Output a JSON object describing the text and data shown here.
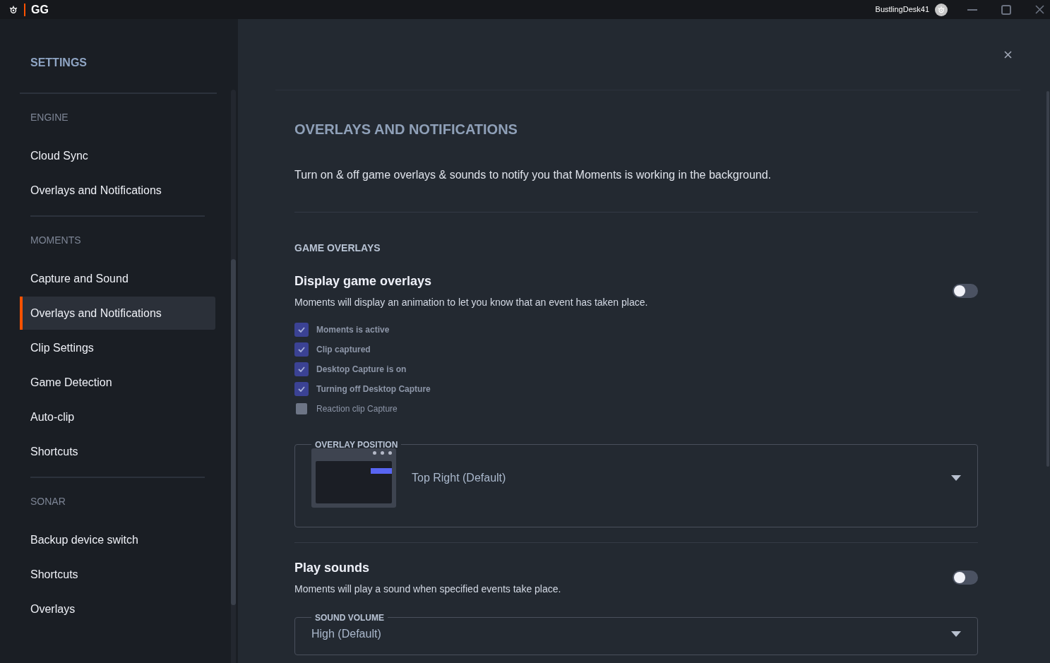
{
  "titlebar": {
    "app_name": "GG",
    "username": "BustlingDesk41"
  },
  "sidebar": {
    "title": "SETTINGS",
    "sections": [
      {
        "header": "ENGINE",
        "items": [
          {
            "label": "Cloud Sync",
            "selected": false
          },
          {
            "label": "Overlays and Notifications",
            "selected": false
          }
        ]
      },
      {
        "header": "MOMENTS",
        "items": [
          {
            "label": "Capture and Sound",
            "selected": false
          },
          {
            "label": "Overlays and Notifications",
            "selected": true
          },
          {
            "label": "Clip Settings",
            "selected": false
          },
          {
            "label": "Game Detection",
            "selected": false
          },
          {
            "label": "Auto-clip",
            "selected": false
          },
          {
            "label": "Shortcuts",
            "selected": false
          }
        ]
      },
      {
        "header": "SONAR",
        "items": [
          {
            "label": "Backup device switch",
            "selected": false
          },
          {
            "label": "Shortcuts",
            "selected": false
          },
          {
            "label": "Overlays",
            "selected": false
          }
        ]
      }
    ]
  },
  "page": {
    "title": "OVERLAYS AND NOTIFICATIONS",
    "description": "Turn on & off game overlays & sounds to notify you that Moments is working in the background.",
    "section_header": "GAME OVERLAYS",
    "overlays": {
      "title": "Display game overlays",
      "description": "Moments will display an animation to let you know that an event has taken place.",
      "on": false,
      "options": [
        {
          "label": "Moments is active",
          "checked": true
        },
        {
          "label": "Clip captured",
          "checked": true
        },
        {
          "label": "Desktop Capture is on",
          "checked": true
        },
        {
          "label": "Turning off Desktop Capture",
          "checked": true
        },
        {
          "label": "Reaction clip Capture",
          "checked": false
        }
      ],
      "position": {
        "legend": "OVERLAY POSITION",
        "value": "Top Right (Default)"
      }
    },
    "sounds": {
      "title": "Play sounds",
      "description": "Moments will play a sound when specified events take place.",
      "on": false,
      "volume": {
        "legend": "SOUND VOLUME",
        "value": "High (Default)"
      }
    }
  }
}
